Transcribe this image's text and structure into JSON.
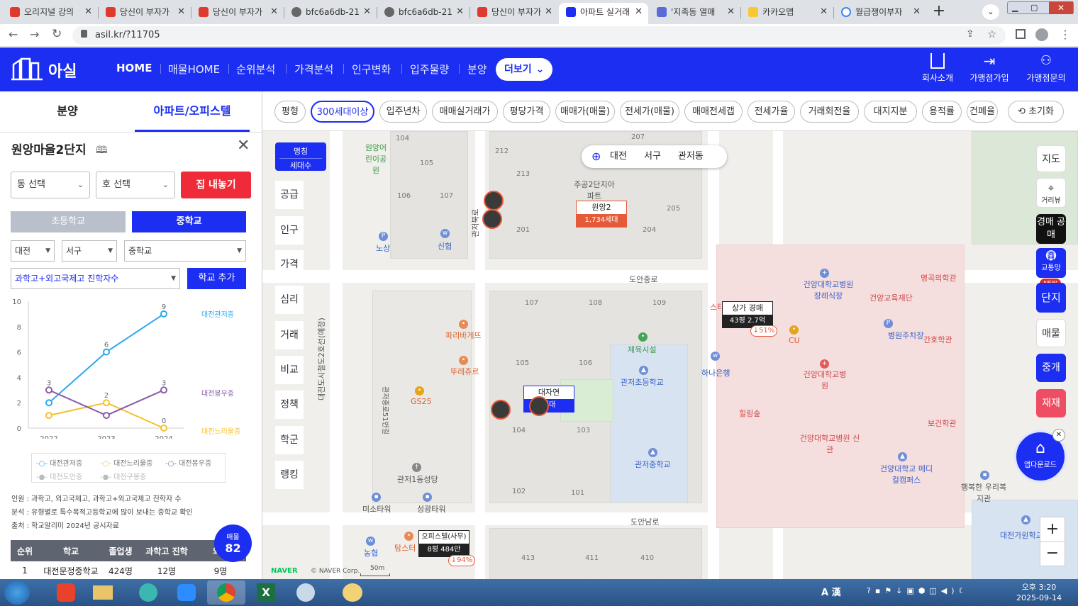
{
  "browser": {
    "tabs": [
      {
        "label": "오리지널 강의",
        "active": false
      },
      {
        "label": "당신이 부자가",
        "active": false
      },
      {
        "label": "당신이 부자가",
        "active": false
      },
      {
        "label": "bfc6a6db-21",
        "active": false
      },
      {
        "label": "bfc6a6db-21",
        "active": false
      },
      {
        "label": "당신이 부자가",
        "active": false
      },
      {
        "label": "아파트 실거래",
        "active": true
      },
      {
        "label": "'지족동 열매",
        "active": false
      },
      {
        "label": "카카오맵",
        "active": false
      },
      {
        "label": "월급쟁이부자",
        "active": false
      }
    ],
    "url": "asil.kr/?11705"
  },
  "header": {
    "logo": "아실",
    "nav": [
      "HOME",
      "매물HOME",
      "순위분석",
      "가격분석",
      "인구변화",
      "입주물량",
      "분양"
    ],
    "more_button": "더보기",
    "right_links": [
      "회사소개",
      "가맹점가입",
      "가맹점문의"
    ]
  },
  "left_panel": {
    "tabs": [
      "분양",
      "아파트/오피스텔"
    ],
    "complex_name": "원앙마을2단지",
    "dong_select": "동 선택",
    "ho_select": "호 선택",
    "list_button": "집 내놓기",
    "school_tabs": [
      "초등학교",
      "중학교"
    ],
    "region_select": "대전",
    "district_select": "서구",
    "school_type_select": "중학교",
    "metric_select": "과학고+외고국제고 진학자수",
    "add_school_button": "학교 추가",
    "legend": [
      "대전관저중",
      "대전느리울중",
      "대전봉우중",
      "대전도안중",
      "대전구봉중"
    ],
    "notes": [
      "인원 : 과학고, 외고국제고, 과학고+외고국제고 진학자 수",
      "분석 : 유형별로 특수목적고등학교에 많이 보내는 중학교 확인",
      "출처 : 학교알리미 2024년 공시자료"
    ],
    "table": {
      "headers": [
        "순위",
        "학교",
        "졸업생",
        "과학고 진학",
        "외고"
      ],
      "rows": [
        [
          "1",
          "대전문정중학교",
          "424명",
          "12명",
          "9명"
        ]
      ]
    },
    "listing_badge": {
      "label": "매물",
      "count": "82"
    }
  },
  "chart_data": {
    "type": "line",
    "x": [
      "2022",
      "2023",
      "2024"
    ],
    "ylim": [
      0,
      10
    ],
    "yticks": [
      0,
      2,
      4,
      6,
      8,
      10
    ],
    "series": [
      {
        "name": "대전관저중",
        "values": [
          2,
          6,
          9
        ],
        "color": "#29a8f0"
      },
      {
        "name": "대전느리울중",
        "values": [
          1,
          2,
          0
        ],
        "color": "#f4c02a"
      },
      {
        "name": "대전봉우중",
        "values": [
          3,
          1,
          3
        ],
        "color": "#8a5ca8"
      }
    ],
    "point_labels": [
      {
        "series": "대전관저중",
        "labels": [
          "",
          "6",
          "9"
        ]
      },
      {
        "series": "대전느리울중",
        "labels": [
          "",
          "2",
          "0"
        ]
      },
      {
        "series": "대전봉우중",
        "labels": [
          "3",
          "",
          "3"
        ]
      }
    ],
    "end_labels": [
      "대전관저중",
      "대전봉우중",
      "대전느리울중"
    ],
    "legend_position": "bottom"
  },
  "filters": [
    "평형",
    "300세대이상",
    "입주년차",
    "매매실거래가",
    "평당가격",
    "매매가(매물)",
    "전세가(매물)",
    "매매전세갭",
    "전세가율",
    "거래회전율",
    "대지지분",
    "용적률",
    "건폐율",
    "초기화"
  ],
  "map": {
    "location": [
      "대전",
      "서구",
      "관저동"
    ],
    "left_tabs_header": [
      "명칭",
      "세대수"
    ],
    "left_tabs": [
      "공급",
      "인구",
      "가격",
      "심리",
      "거래",
      "비교",
      "정책",
      "학군",
      "랭킹"
    ],
    "right_buttons": [
      "지도",
      "거리뷰",
      "경매 공매",
      "교통망",
      "단지",
      "매물",
      "중개",
      "재재"
    ],
    "new_badge": "NEW",
    "download_button": "앱다운로드",
    "zoom": [
      "+",
      "−"
    ],
    "markers": [
      {
        "title": "원앙2",
        "sub": "1,734세대"
      },
      {
        "title": "상가 경매",
        "sub": "43평 2.7억",
        "pct": "↓51%"
      },
      {
        "title": "대자연",
        "sub": "세대"
      },
      {
        "title": "오피스텔(사무)",
        "sub": "8평 484만",
        "pct": "↓94%"
      }
    ],
    "labels": [
      "원앙어린이공원",
      "주공2단지아파트",
      "노상",
      "신협",
      "도안중로",
      "파리바게뜨",
      "뚜레쥬르",
      "체육시설",
      "관저초등학교",
      "GS25",
      "관저중학교",
      "관저1동성당",
      "미소타워",
      "성광타워",
      "농협",
      "탐스터",
      "하나은행",
      "건양대학교병원 장례식장",
      "건양교육재단",
      "명곡의학관",
      "병원주차장",
      "간호학관",
      "CU",
      "건양대학교병원",
      "힐링숲",
      "건양대학교병원 신관",
      "보건학관",
      "건양대학교 메디컬캠퍼스",
      "행복한 우리복지관",
      "대전가원학교",
      "도안남로",
      "대전도시철도2호선(예정)",
      "관저북로",
      "관저중로51번길",
      "대자연",
      "스타"
    ],
    "block_numbers": [
      "104",
      "105",
      "212",
      "213",
      "106",
      "107",
      "201",
      "204",
      "205",
      "207",
      "107",
      "108",
      "109",
      "105",
      "106",
      "104",
      "103",
      "102",
      "101",
      "413",
      "411",
      "410"
    ],
    "scale": "50m",
    "naver": "NAVER",
    "copyright": "© NAVER Corp."
  },
  "taskbar": {
    "time": "오후 3:20",
    "date": "2025-09-14",
    "ime": "A 漢"
  }
}
